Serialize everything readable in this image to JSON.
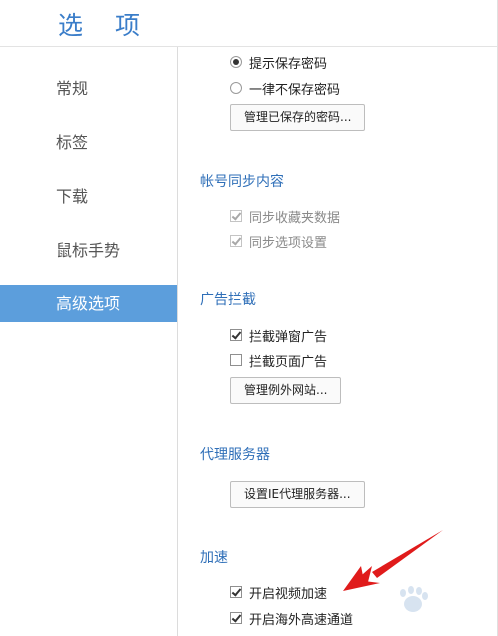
{
  "header": {
    "title": "选 项"
  },
  "sidebar": {
    "items": [
      {
        "label": "常规"
      },
      {
        "label": "标签"
      },
      {
        "label": "下载"
      },
      {
        "label": "鼠标手势"
      },
      {
        "label": "高级选项"
      }
    ],
    "active_index": 4
  },
  "password": {
    "options": [
      {
        "label": "提示保存密码",
        "selected": true
      },
      {
        "label": "一律不保存密码",
        "selected": false
      }
    ],
    "manage_button": "管理已保存的密码..."
  },
  "sync": {
    "title": "帐号同步内容",
    "options": [
      {
        "label": "同步收藏夹数据",
        "checked": true,
        "disabled": true
      },
      {
        "label": "同步选项设置",
        "checked": true,
        "disabled": true
      }
    ]
  },
  "adblock": {
    "title": "广告拦截",
    "options": [
      {
        "label": "拦截弹窗广告",
        "checked": true
      },
      {
        "label": "拦截页面广告",
        "checked": false
      }
    ],
    "manage_button": "管理例外网站..."
  },
  "proxy": {
    "title": "代理服务器",
    "button": "设置IE代理服务器..."
  },
  "accel": {
    "title": "加速",
    "options": [
      {
        "label": "开启视频加速",
        "checked": true
      },
      {
        "label": "开启海外高速通道",
        "checked": true
      }
    ]
  },
  "colors": {
    "accent": "#3a7dc9",
    "active_nav": "#5c9edc",
    "annotation_arrow": "#e01b1b"
  }
}
